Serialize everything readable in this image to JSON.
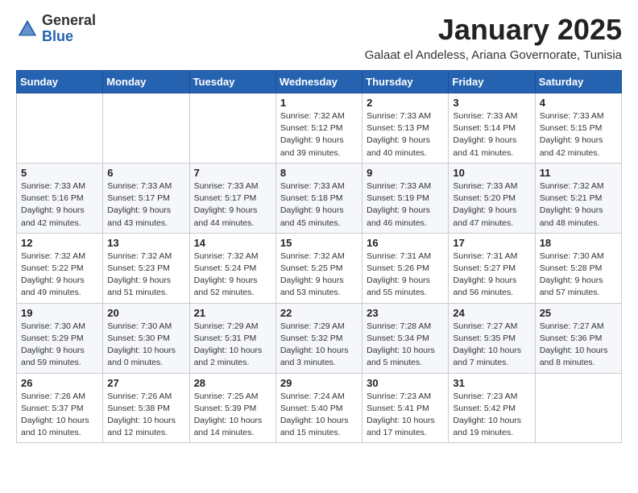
{
  "logo": {
    "general": "General",
    "blue": "Blue"
  },
  "header": {
    "title": "January 2025",
    "subtitle": "Galaat el Andeless, Ariana Governorate, Tunisia"
  },
  "days_of_week": [
    "Sunday",
    "Monday",
    "Tuesday",
    "Wednesday",
    "Thursday",
    "Friday",
    "Saturday"
  ],
  "weeks": [
    [
      {
        "day": "",
        "info": ""
      },
      {
        "day": "",
        "info": ""
      },
      {
        "day": "",
        "info": ""
      },
      {
        "day": "1",
        "info": "Sunrise: 7:32 AM\nSunset: 5:12 PM\nDaylight: 9 hours\nand 39 minutes."
      },
      {
        "day": "2",
        "info": "Sunrise: 7:33 AM\nSunset: 5:13 PM\nDaylight: 9 hours\nand 40 minutes."
      },
      {
        "day": "3",
        "info": "Sunrise: 7:33 AM\nSunset: 5:14 PM\nDaylight: 9 hours\nand 41 minutes."
      },
      {
        "day": "4",
        "info": "Sunrise: 7:33 AM\nSunset: 5:15 PM\nDaylight: 9 hours\nand 42 minutes."
      }
    ],
    [
      {
        "day": "5",
        "info": "Sunrise: 7:33 AM\nSunset: 5:16 PM\nDaylight: 9 hours\nand 42 minutes."
      },
      {
        "day": "6",
        "info": "Sunrise: 7:33 AM\nSunset: 5:17 PM\nDaylight: 9 hours\nand 43 minutes."
      },
      {
        "day": "7",
        "info": "Sunrise: 7:33 AM\nSunset: 5:17 PM\nDaylight: 9 hours\nand 44 minutes."
      },
      {
        "day": "8",
        "info": "Sunrise: 7:33 AM\nSunset: 5:18 PM\nDaylight: 9 hours\nand 45 minutes."
      },
      {
        "day": "9",
        "info": "Sunrise: 7:33 AM\nSunset: 5:19 PM\nDaylight: 9 hours\nand 46 minutes."
      },
      {
        "day": "10",
        "info": "Sunrise: 7:33 AM\nSunset: 5:20 PM\nDaylight: 9 hours\nand 47 minutes."
      },
      {
        "day": "11",
        "info": "Sunrise: 7:32 AM\nSunset: 5:21 PM\nDaylight: 9 hours\nand 48 minutes."
      }
    ],
    [
      {
        "day": "12",
        "info": "Sunrise: 7:32 AM\nSunset: 5:22 PM\nDaylight: 9 hours\nand 49 minutes."
      },
      {
        "day": "13",
        "info": "Sunrise: 7:32 AM\nSunset: 5:23 PM\nDaylight: 9 hours\nand 51 minutes."
      },
      {
        "day": "14",
        "info": "Sunrise: 7:32 AM\nSunset: 5:24 PM\nDaylight: 9 hours\nand 52 minutes."
      },
      {
        "day": "15",
        "info": "Sunrise: 7:32 AM\nSunset: 5:25 PM\nDaylight: 9 hours\nand 53 minutes."
      },
      {
        "day": "16",
        "info": "Sunrise: 7:31 AM\nSunset: 5:26 PM\nDaylight: 9 hours\nand 55 minutes."
      },
      {
        "day": "17",
        "info": "Sunrise: 7:31 AM\nSunset: 5:27 PM\nDaylight: 9 hours\nand 56 minutes."
      },
      {
        "day": "18",
        "info": "Sunrise: 7:30 AM\nSunset: 5:28 PM\nDaylight: 9 hours\nand 57 minutes."
      }
    ],
    [
      {
        "day": "19",
        "info": "Sunrise: 7:30 AM\nSunset: 5:29 PM\nDaylight: 9 hours\nand 59 minutes."
      },
      {
        "day": "20",
        "info": "Sunrise: 7:30 AM\nSunset: 5:30 PM\nDaylight: 10 hours\nand 0 minutes."
      },
      {
        "day": "21",
        "info": "Sunrise: 7:29 AM\nSunset: 5:31 PM\nDaylight: 10 hours\nand 2 minutes."
      },
      {
        "day": "22",
        "info": "Sunrise: 7:29 AM\nSunset: 5:32 PM\nDaylight: 10 hours\nand 3 minutes."
      },
      {
        "day": "23",
        "info": "Sunrise: 7:28 AM\nSunset: 5:34 PM\nDaylight: 10 hours\nand 5 minutes."
      },
      {
        "day": "24",
        "info": "Sunrise: 7:27 AM\nSunset: 5:35 PM\nDaylight: 10 hours\nand 7 minutes."
      },
      {
        "day": "25",
        "info": "Sunrise: 7:27 AM\nSunset: 5:36 PM\nDaylight: 10 hours\nand 8 minutes."
      }
    ],
    [
      {
        "day": "26",
        "info": "Sunrise: 7:26 AM\nSunset: 5:37 PM\nDaylight: 10 hours\nand 10 minutes."
      },
      {
        "day": "27",
        "info": "Sunrise: 7:26 AM\nSunset: 5:38 PM\nDaylight: 10 hours\nand 12 minutes."
      },
      {
        "day": "28",
        "info": "Sunrise: 7:25 AM\nSunset: 5:39 PM\nDaylight: 10 hours\nand 14 minutes."
      },
      {
        "day": "29",
        "info": "Sunrise: 7:24 AM\nSunset: 5:40 PM\nDaylight: 10 hours\nand 15 minutes."
      },
      {
        "day": "30",
        "info": "Sunrise: 7:23 AM\nSunset: 5:41 PM\nDaylight: 10 hours\nand 17 minutes."
      },
      {
        "day": "31",
        "info": "Sunrise: 7:23 AM\nSunset: 5:42 PM\nDaylight: 10 hours\nand 19 minutes."
      },
      {
        "day": "",
        "info": ""
      }
    ]
  ]
}
